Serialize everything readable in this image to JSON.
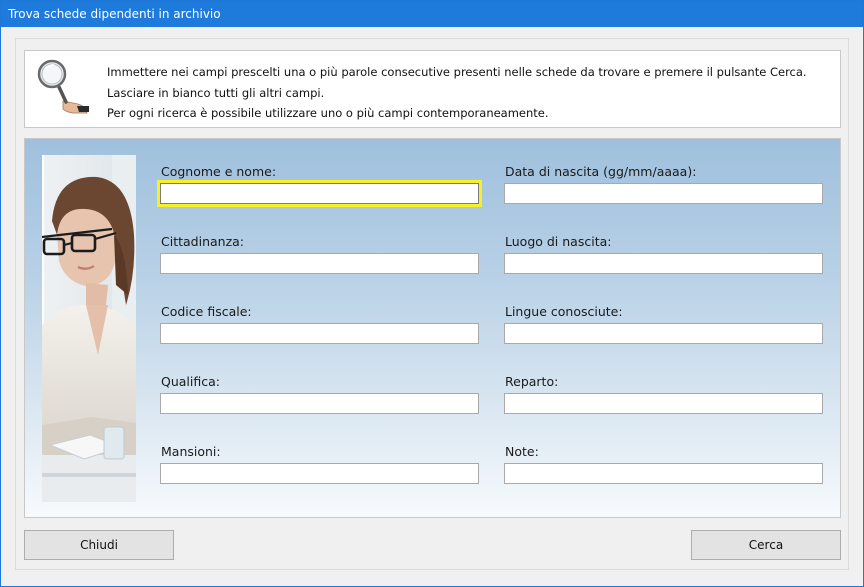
{
  "window": {
    "title": "Trova schede dipendenti in archivio"
  },
  "info": {
    "icon": "magnifier-in-hand-icon",
    "lines": [
      "Immettere nei campi prescelti una o più parole consecutive presenti nelle schede da trovare e premere il pulsante Cerca.",
      "Lasciare in bianco tutti gli altri campi.",
      "Per ogni ricerca è possibile utilizzare uno o più campi contemporaneamente."
    ]
  },
  "form": {
    "fields": [
      {
        "label": "Cognome e nome:",
        "value": ""
      },
      {
        "label": "Data di nascita (gg/mm/aaaa):",
        "value": ""
      },
      {
        "label": "Cittadinanza:",
        "value": ""
      },
      {
        "label": "Luogo di nascita:",
        "value": ""
      },
      {
        "label": "Codice fiscale:",
        "value": ""
      },
      {
        "label": "Lingue conosciute:",
        "value": ""
      },
      {
        "label": "Qualifica:",
        "value": ""
      },
      {
        "label": "Reparto:",
        "value": ""
      },
      {
        "label": "Mansioni:",
        "value": ""
      },
      {
        "label": "Note:",
        "value": ""
      }
    ],
    "focus_color": "#f6f02a"
  },
  "buttons": {
    "close_label": "Chiudi",
    "search_label": "Cerca"
  },
  "colors": {
    "titlebar": "#1e7bdc",
    "panel_top": "#9fc0dd",
    "panel_bottom": "#f7fafd"
  }
}
